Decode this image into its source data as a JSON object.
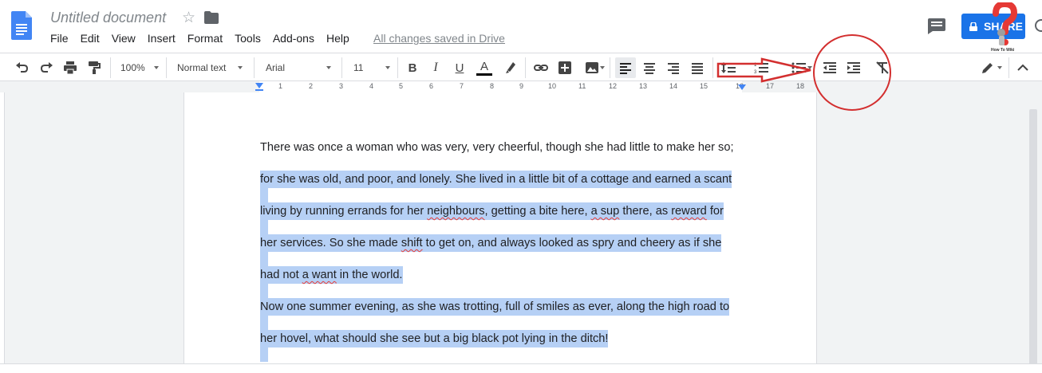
{
  "app": {
    "doc_title": "Untitled document",
    "menu": [
      "File",
      "Edit",
      "View",
      "Insert",
      "Format",
      "Tools",
      "Add-ons",
      "Help"
    ],
    "save_status": "All changes saved in Drive",
    "share_label": "SHARE"
  },
  "toolbar": {
    "zoom": "100%",
    "style": "Normal text",
    "font": "Arial",
    "size": "11",
    "text_color": "#000000"
  },
  "ruler": {
    "numbers": [
      "1",
      "2",
      "3",
      "4",
      "5",
      "6",
      "7",
      "8",
      "9",
      "10",
      "11",
      "12",
      "13",
      "14",
      "15",
      "16",
      "17",
      "18"
    ]
  },
  "document": {
    "lines": [
      {
        "text": "There was once a woman who was very, very cheerful, though she had little to make her so;",
        "selected": false
      },
      {
        "text": "for she was old, and poor, and lonely. She lived in a little bit of a cottage and earned a scant ",
        "selected": true
      },
      {
        "segments": [
          [
            "living by running errands for her ",
            false
          ],
          [
            "neighbours",
            true
          ],
          [
            ", getting a bite here, ",
            false
          ],
          [
            "a sup",
            true
          ],
          [
            " there, as ",
            false
          ],
          [
            "reward",
            true
          ],
          [
            " for ",
            false
          ]
        ],
        "selected": true
      },
      {
        "segments": [
          [
            "her services. So she made ",
            false
          ],
          [
            "shift",
            true
          ],
          [
            " to get on, and always looked as spry and cheery as if she ",
            false
          ]
        ],
        "selected": true
      },
      {
        "segments": [
          [
            "had not ",
            false
          ],
          [
            "a want",
            true
          ],
          [
            " in the world. ",
            false
          ]
        ],
        "selected": true
      },
      {
        "text": "Now one summer evening, as she was trotting, full of smiles as ever, along the high road to ",
        "selected": true
      },
      {
        "text": "her hovel, what should she see but a big black pot lying in the ditch! ",
        "selected": true
      }
    ]
  },
  "watermark": {
    "text": "How To Wiki"
  },
  "colors": {
    "accent": "#1a73e8",
    "selection": "#b6d0f5",
    "annotation": "#d32f2f"
  }
}
